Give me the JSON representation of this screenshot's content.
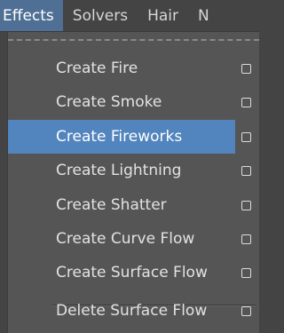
{
  "menubar": {
    "items": [
      {
        "label": "Effects",
        "active": true
      },
      {
        "label": "Solvers",
        "active": false
      },
      {
        "label": "Hair",
        "active": false
      },
      {
        "label": "N",
        "active": false
      }
    ]
  },
  "effects_menu": {
    "items": [
      {
        "label": "Create Fire",
        "has_option_box": true
      },
      {
        "label": "Create Smoke",
        "has_option_box": true
      },
      {
        "label": "Create Fireworks",
        "has_option_box": true,
        "highlighted": true
      },
      {
        "label": "Create Lightning",
        "has_option_box": true
      },
      {
        "label": "Create Shatter",
        "has_option_box": true
      },
      {
        "label": "Create Curve Flow",
        "has_option_box": true
      },
      {
        "label": "Create Surface Flow",
        "has_option_box": true
      },
      {
        "label": "Delete Surface Flow",
        "has_option_box": true
      }
    ]
  },
  "colors": {
    "menubar_active": "#4f6f94",
    "menu_highlight": "#5284be",
    "menu_background": "#555555"
  }
}
